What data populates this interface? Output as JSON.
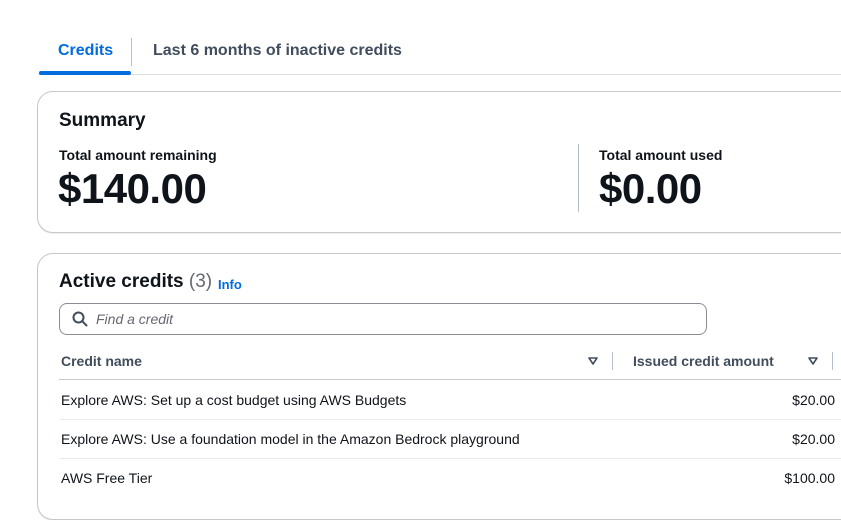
{
  "tabs": [
    {
      "label": "Credits",
      "active": true
    },
    {
      "label": "Last 6 months of inactive credits",
      "active": false
    }
  ],
  "summary": {
    "title": "Summary",
    "metrics": [
      {
        "label": "Total amount remaining",
        "value": "$140.00"
      },
      {
        "label": "Total amount used",
        "value": "$0.00"
      }
    ]
  },
  "active_credits": {
    "title": "Active credits",
    "count": "(3)",
    "info_label": "Info",
    "search": {
      "placeholder": "Find a credit",
      "value": ""
    },
    "columns": [
      "Credit name",
      "Issued credit amount"
    ],
    "rows": [
      {
        "name": "Explore AWS: Set up a cost budget using AWS Budgets",
        "amount": "$20.00"
      },
      {
        "name": "Explore AWS: Use a foundation model in the Amazon Bedrock playground",
        "amount": "$20.00"
      },
      {
        "name": "AWS Free Tier",
        "amount": "$100.00"
      }
    ]
  },
  "colors": {
    "accent": "#006ce0",
    "text": "#0f141a",
    "muted": "#414d5c",
    "border": "#c6c6cd"
  },
  "icons": [
    "search-icon",
    "sort-caret-down-icon"
  ]
}
